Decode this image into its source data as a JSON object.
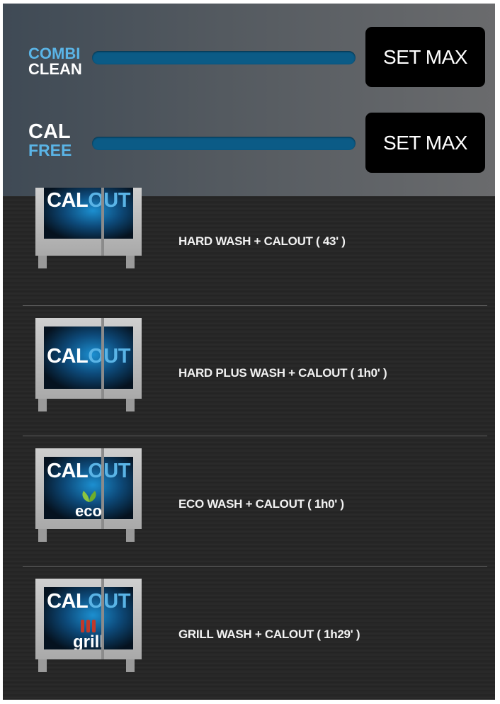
{
  "top_panel": {
    "combi_clean": {
      "label_line1": "COMBI",
      "label_line2": "CLEAN",
      "button_label": "SET MAX"
    },
    "cal_free": {
      "label_line1": "CAL",
      "label_line2": "FREE",
      "button_label": "SET MAX"
    }
  },
  "programs": [
    {
      "name": "HARD WASH + CALOUT ( 43' )",
      "icon_text_a": "CAL",
      "icon_text_b": "OUT",
      "variant": "hard"
    },
    {
      "name": "HARD PLUS WASH + CALOUT ( 1h0' )",
      "icon_text_a": "CAL",
      "icon_text_b": "OUT",
      "variant": "hard-plus"
    },
    {
      "name": "ECO WASH + CALOUT ( 1h0' )",
      "icon_text_a": "CAL",
      "icon_text_b": "OUT",
      "sub_text": "eco",
      "variant": "eco"
    },
    {
      "name": "GRILL WASH + CALOUT ( 1h29' )",
      "icon_text_a": "CAL",
      "icon_text_b": "OUT",
      "sub_text": "grill",
      "variant": "grill"
    }
  ],
  "colors": {
    "accent_blue": "#5ab4e6",
    "bar_blue": "#0b5b86",
    "button_bg": "#000000",
    "eco_leaf": "#8cc63f",
    "grill_red": "#c0392b"
  }
}
